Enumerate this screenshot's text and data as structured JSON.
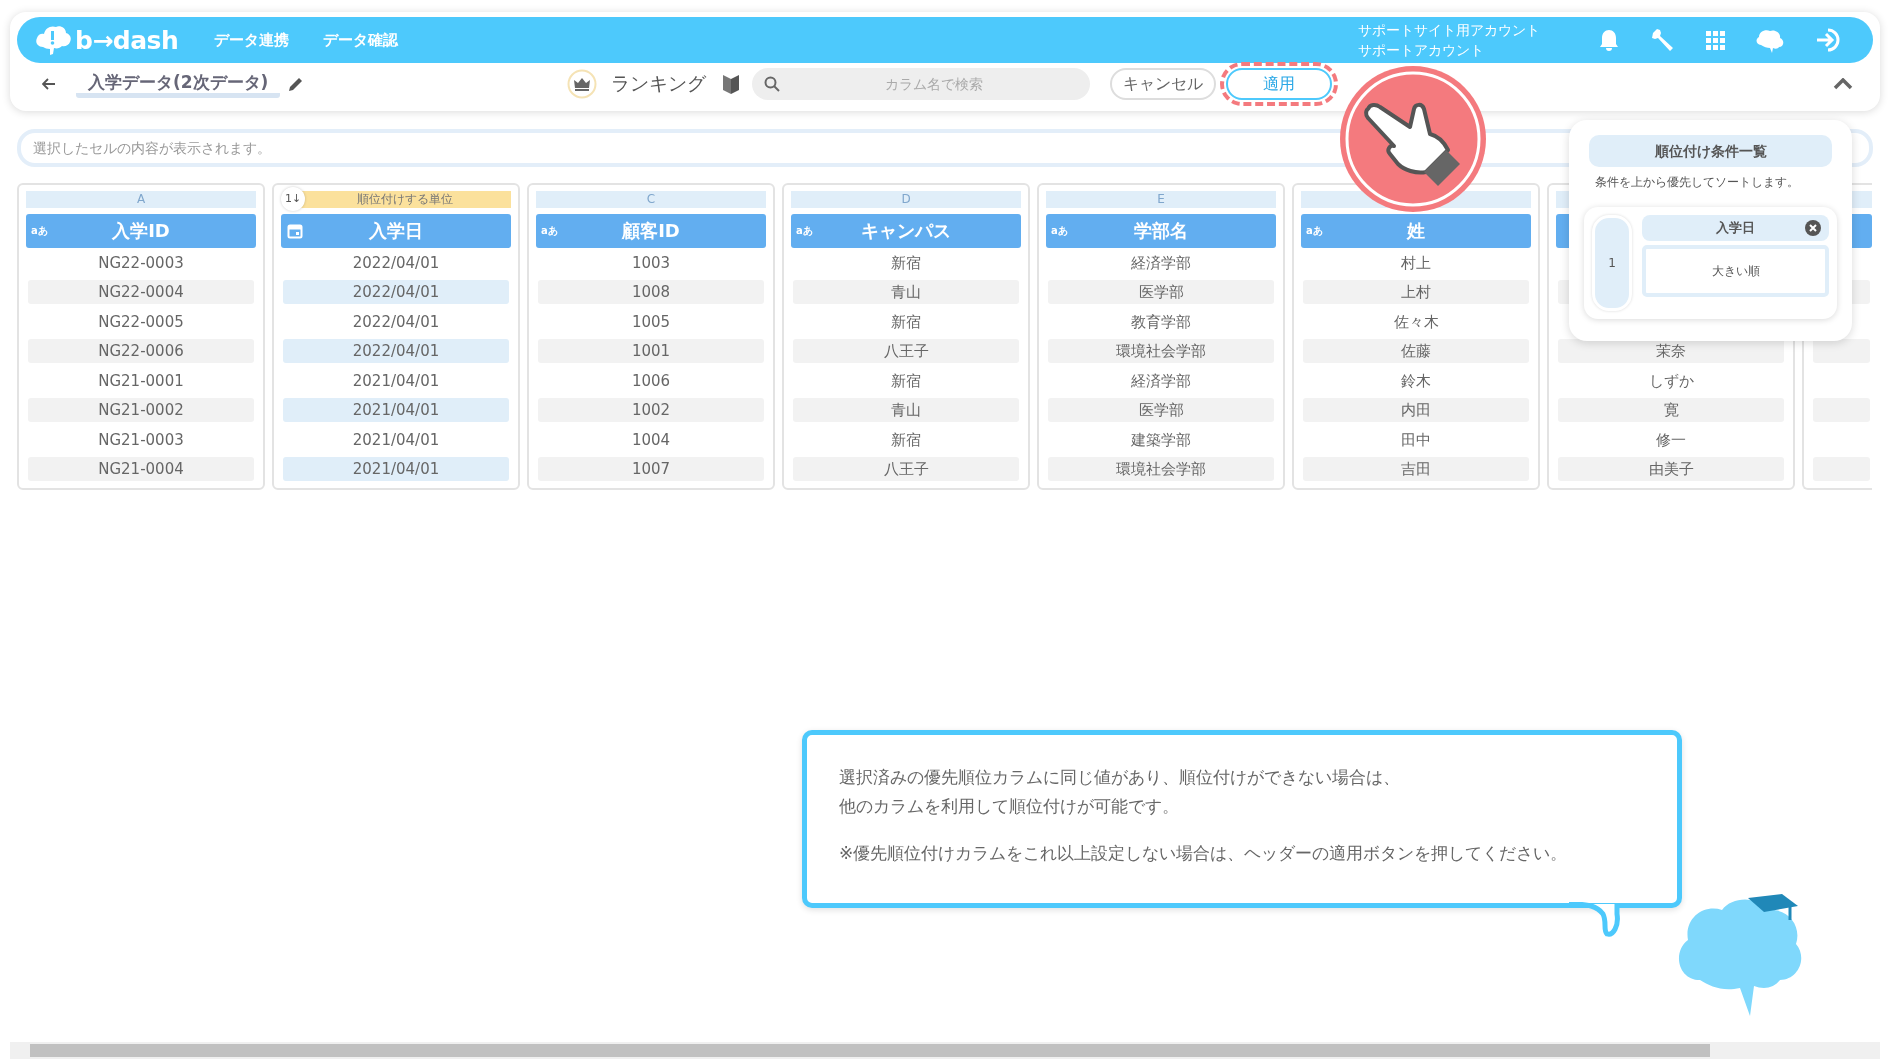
{
  "header": {
    "logo": "b→dash",
    "nav": [
      "データ連携",
      "データ確認"
    ],
    "account": [
      "サポートサイト用アカウント",
      "サポートアカウント"
    ]
  },
  "toolbar": {
    "title": "入学データ(2次データ)",
    "mode": "ランキング",
    "search": {
      "placeholder": "カラム名で検索"
    },
    "buttons": [
      {
        "label": "キャンセル",
        "kind": "cancel",
        "highlighted": false
      },
      {
        "label": "適用",
        "kind": "apply",
        "highlighted": true
      }
    ]
  },
  "cell_bar": {
    "placeholder": "選択したセルの内容が表示されます。"
  },
  "columns": [
    {
      "letter": "A",
      "kind": "text",
      "type_label": "aあ",
      "name": "入学ID",
      "selected": false,
      "cells": [
        "NG22-0003",
        "NG22-0004",
        "NG22-0005",
        "NG22-0006",
        "NG21-0001",
        "NG21-0002",
        "NG21-0003",
        "NG21-0004"
      ]
    },
    {
      "kind": "date",
      "name": "入学日",
      "selected": true,
      "rank_badge": "1↓",
      "rank_unit": "順位付けする単位",
      "cells": [
        "2022/04/01",
        "2022/04/01",
        "2022/04/01",
        "2022/04/01",
        "2021/04/01",
        "2021/04/01",
        "2021/04/01",
        "2021/04/01"
      ]
    },
    {
      "letter": "C",
      "kind": "text",
      "type_label": "aあ",
      "name": "顧客ID",
      "selected": false,
      "cells": [
        "1003",
        "1008",
        "1005",
        "1001",
        "1006",
        "1002",
        "1004",
        "1007"
      ]
    },
    {
      "letter": "D",
      "kind": "text",
      "type_label": "aあ",
      "name": "キャンパス",
      "selected": false,
      "cells": [
        "新宿",
        "青山",
        "新宿",
        "八王子",
        "新宿",
        "青山",
        "新宿",
        "八王子"
      ]
    },
    {
      "letter": "E",
      "kind": "text",
      "type_label": "aあ",
      "name": "学部名",
      "selected": false,
      "cells": [
        "経済学部",
        "医学部",
        "教育学部",
        "環境社会学部",
        "経済学部",
        "医学部",
        "建築学部",
        "環境社会学部"
      ]
    },
    {
      "kind": "text",
      "type_label": "aあ",
      "name": "姓",
      "selected": false,
      "cells": [
        "村上",
        "上村",
        "佐々木",
        "佐藤",
        "鈴木",
        "内田",
        "田中",
        "吉田"
      ]
    },
    {
      "kind": "text",
      "selected": false,
      "cells": [
        null,
        null,
        null,
        "茉奈",
        "しずか",
        "寛",
        "修一",
        "由美子"
      ]
    },
    {
      "kind": "text",
      "selected": false,
      "cells": [
        null,
        null,
        null,
        null,
        null,
        null,
        null,
        null
      ]
    }
  ],
  "ranking_panel": {
    "title": "順位付け条件一覧",
    "subtitle": "条件を上から優先してソートします。",
    "conditions": [
      {
        "rank": "1",
        "column": "入学日",
        "order": "大きい順"
      }
    ]
  },
  "tip": {
    "paragraphs": [
      [
        "選択済みの優先順位カラムに同じ値があり、順位付けができない場合は、",
        "他のカラムを利用して順位付けが可能です。"
      ],
      [
        "※優先順位付けカラムをこれ以上設定しない場合は、ヘッダーの適用ボタンを押してください。"
      ]
    ]
  }
}
